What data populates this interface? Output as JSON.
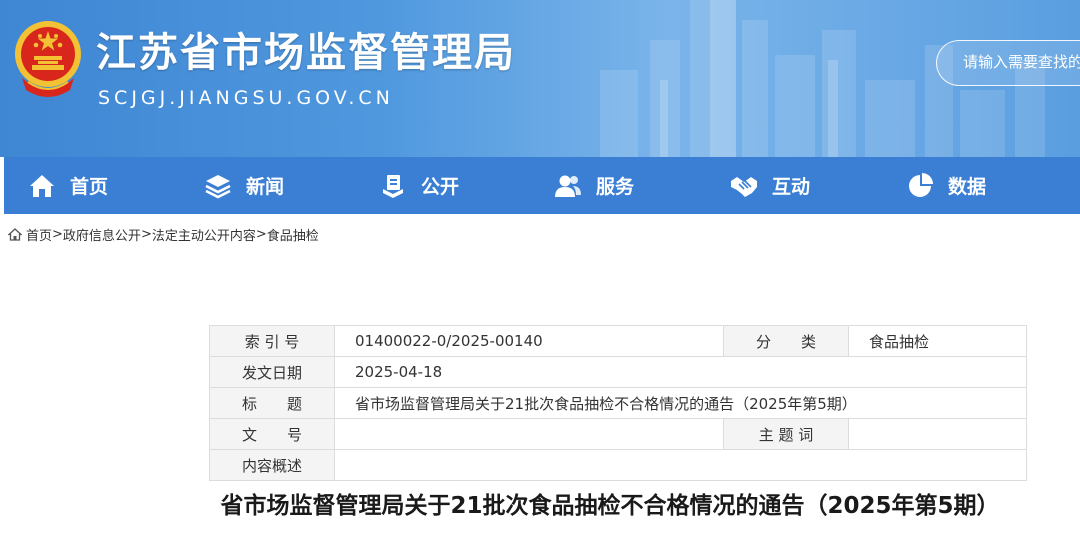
{
  "header": {
    "site_title": "江苏省市场监督管理局",
    "site_domain": "SCJGJ.JIANGSU.GOV.CN",
    "search_placeholder": "请输入需要查找的",
    "emblem_icon": "national-emblem-icon"
  },
  "colors": {
    "header_blue": "#4f98de",
    "nav_blue": "#3a7fd4",
    "table_key_bg": "#f4f4f4",
    "table_border": "#dcdcdc"
  },
  "nav": {
    "items": [
      {
        "label": "首页",
        "icon": "home-icon"
      },
      {
        "label": "新闻",
        "icon": "layers-icon"
      },
      {
        "label": "公开",
        "icon": "document-stack-icon"
      },
      {
        "label": "服务",
        "icon": "people-icon"
      },
      {
        "label": "互动",
        "icon": "handshake-icon"
      },
      {
        "label": "数据",
        "icon": "pie-chart-icon"
      }
    ]
  },
  "breadcrumb": {
    "items": [
      "首页",
      "政府信息公开",
      "法定主动公开内容",
      "食品抽检"
    ],
    "separator": ">"
  },
  "info": {
    "index_label": "索 引 号",
    "index_value": "01400022-0/2025-00140",
    "category_label": "分　　类",
    "category_value": "食品抽检",
    "date_label": "发文日期",
    "date_value": "2025-04-18",
    "title_label": "标　　题",
    "title_value": "省市场监督管理局关于21批次食品抽检不合格情况的通告（2025年第5期）",
    "docno_label": "文　　号",
    "docno_value": "",
    "keywords_label": "主 题 词",
    "keywords_value": "",
    "summary_label": "内容概述",
    "summary_value": ""
  },
  "article": {
    "title": "省市场监督管理局关于21批次食品抽检不合格情况的通告（2025年第5期）"
  }
}
